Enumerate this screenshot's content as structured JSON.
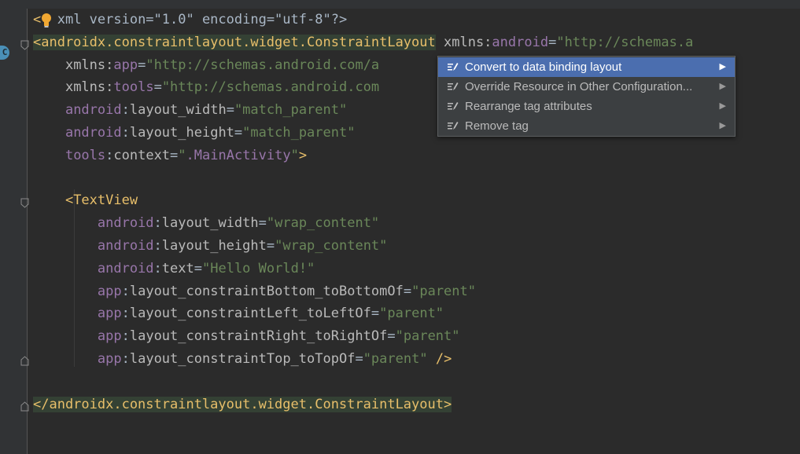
{
  "editor": {
    "gutter_class_marker": "C",
    "lines": [
      [
        {
          "c": "t-tag",
          "t": "<"
        },
        {
          "c": "t-text",
          "t": "  xml version=\"1.0\" encoding=\"utf-8\"?>"
        }
      ],
      [
        {
          "c": "t-tag",
          "t": "<androidx.constraintlayout.widget.ConstraintLayout"
        },
        {
          "c": "t-text",
          "t": " "
        },
        {
          "c": "t-attr",
          "t": "xmlns:"
        },
        {
          "c": "t-ns",
          "t": "android"
        },
        {
          "c": "t-text",
          "t": "="
        },
        {
          "c": "t-val",
          "t": "\"http://schemas.a"
        }
      ],
      [
        {
          "c": "t-text",
          "t": "    "
        },
        {
          "c": "t-attr",
          "t": "xmlns:"
        },
        {
          "c": "t-ns",
          "t": "app"
        },
        {
          "c": "t-text",
          "t": "="
        },
        {
          "c": "t-val",
          "t": "\"http://schemas.android.com/a"
        }
      ],
      [
        {
          "c": "t-text",
          "t": "    "
        },
        {
          "c": "t-attr",
          "t": "xmlns:"
        },
        {
          "c": "t-ns",
          "t": "tools"
        },
        {
          "c": "t-text",
          "t": "="
        },
        {
          "c": "t-val",
          "t": "\"http://schemas.android.com"
        }
      ],
      [
        {
          "c": "t-text",
          "t": "    "
        },
        {
          "c": "t-ns",
          "t": "android"
        },
        {
          "c": "t-text",
          "t": ":"
        },
        {
          "c": "t-attr",
          "t": "layout_width"
        },
        {
          "c": "t-text",
          "t": "="
        },
        {
          "c": "t-val",
          "t": "\"match_parent\""
        }
      ],
      [
        {
          "c": "t-text",
          "t": "    "
        },
        {
          "c": "t-ns",
          "t": "android"
        },
        {
          "c": "t-text",
          "t": ":"
        },
        {
          "c": "t-attr",
          "t": "layout_height"
        },
        {
          "c": "t-text",
          "t": "="
        },
        {
          "c": "t-val",
          "t": "\"match_parent\""
        }
      ],
      [
        {
          "c": "t-text",
          "t": "    "
        },
        {
          "c": "t-ns",
          "t": "tools"
        },
        {
          "c": "t-text",
          "t": ":"
        },
        {
          "c": "t-attr",
          "t": "context"
        },
        {
          "c": "t-text",
          "t": "="
        },
        {
          "c": "t-val",
          "t": "\""
        },
        {
          "c": "t-ref",
          "t": ".MainActivity"
        },
        {
          "c": "t-val",
          "t": "\""
        },
        {
          "c": "t-tag",
          "t": ">"
        }
      ],
      [
        {
          "c": "t-text",
          "t": ""
        }
      ],
      [
        {
          "c": "t-text",
          "t": "    "
        },
        {
          "c": "t-tag",
          "t": "<TextView"
        }
      ],
      [
        {
          "c": "t-text",
          "t": "        "
        },
        {
          "c": "t-ns",
          "t": "android"
        },
        {
          "c": "t-text",
          "t": ":"
        },
        {
          "c": "t-attr",
          "t": "layout_width"
        },
        {
          "c": "t-text",
          "t": "="
        },
        {
          "c": "t-val",
          "t": "\"wrap_content\""
        }
      ],
      [
        {
          "c": "t-text",
          "t": "        "
        },
        {
          "c": "t-ns",
          "t": "android"
        },
        {
          "c": "t-text",
          "t": ":"
        },
        {
          "c": "t-attr",
          "t": "layout_height"
        },
        {
          "c": "t-text",
          "t": "="
        },
        {
          "c": "t-val",
          "t": "\"wrap_content\""
        }
      ],
      [
        {
          "c": "t-text",
          "t": "        "
        },
        {
          "c": "t-ns",
          "t": "android"
        },
        {
          "c": "t-text",
          "t": ":"
        },
        {
          "c": "t-attr",
          "t": "text"
        },
        {
          "c": "t-text",
          "t": "="
        },
        {
          "c": "t-val",
          "t": "\"Hello World!\""
        }
      ],
      [
        {
          "c": "t-text",
          "t": "        "
        },
        {
          "c": "t-ns",
          "t": "app"
        },
        {
          "c": "t-text",
          "t": ":"
        },
        {
          "c": "t-attr",
          "t": "layout_constraintBottom_toBottomOf"
        },
        {
          "c": "t-text",
          "t": "="
        },
        {
          "c": "t-val",
          "t": "\"parent\""
        }
      ],
      [
        {
          "c": "t-text",
          "t": "        "
        },
        {
          "c": "t-ns",
          "t": "app"
        },
        {
          "c": "t-text",
          "t": ":"
        },
        {
          "c": "t-attr",
          "t": "layout_constraintLeft_toLeftOf"
        },
        {
          "c": "t-text",
          "t": "="
        },
        {
          "c": "t-val",
          "t": "\"parent\""
        }
      ],
      [
        {
          "c": "t-text",
          "t": "        "
        },
        {
          "c": "t-ns",
          "t": "app"
        },
        {
          "c": "t-text",
          "t": ":"
        },
        {
          "c": "t-attr",
          "t": "layout_constraintRight_toRightOf"
        },
        {
          "c": "t-text",
          "t": "="
        },
        {
          "c": "t-val",
          "t": "\"parent\""
        }
      ],
      [
        {
          "c": "t-text",
          "t": "        "
        },
        {
          "c": "t-ns",
          "t": "app"
        },
        {
          "c": "t-text",
          "t": ":"
        },
        {
          "c": "t-attr",
          "t": "layout_constraintTop_toTopOf"
        },
        {
          "c": "t-text",
          "t": "="
        },
        {
          "c": "t-val",
          "t": "\"parent\""
        },
        {
          "c": "t-text",
          "t": " "
        },
        {
          "c": "t-tag",
          "t": "/>"
        }
      ],
      [
        {
          "c": "t-text",
          "t": ""
        }
      ],
      [
        {
          "c": "t-tag",
          "t": "</androidx.constraintlayout.widget.ConstraintLayout>"
        }
      ]
    ]
  },
  "intention_menu": {
    "items": [
      {
        "label": "Convert to data binding layout",
        "selected": true,
        "submenu_arrow": "▶"
      },
      {
        "label": "Override Resource in Other Configuration...",
        "selected": false,
        "submenu_arrow": "▶"
      },
      {
        "label": "Rearrange tag attributes",
        "selected": false,
        "submenu_arrow": "▶"
      },
      {
        "label": "Remove tag",
        "selected": false,
        "submenu_arrow": "▶"
      }
    ],
    "item_icon": "edit-icon"
  },
  "colors": {
    "background": "#2b2b2b",
    "gutter": "#313335",
    "tag": "#e8bf6a",
    "namespace": "#9876aa",
    "attribute": "#bababa",
    "value": "#6a8759",
    "menu_background": "#3c3f41",
    "menu_selected": "#4b6eaf",
    "tag_highlight": "#344134"
  }
}
